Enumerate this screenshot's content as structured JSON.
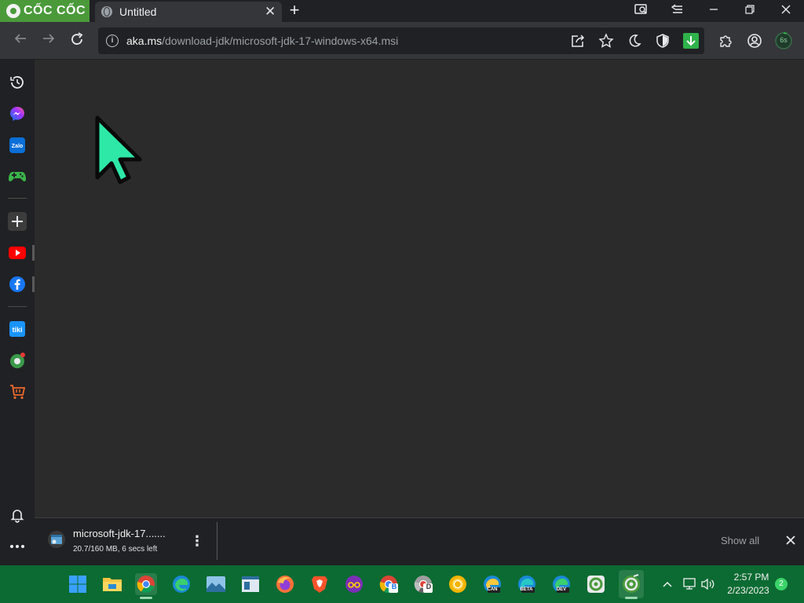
{
  "browser": {
    "brand": "CỐC CỐC",
    "tab_title": "Untitled",
    "url_host": "aka.ms",
    "url_path": "/download-jdk/microsoft-jdk-17-windows-x64.msi",
    "download_badge_text": "6s"
  },
  "download_shelf": {
    "file_name": "microsoft-jdk-17.......",
    "status": "20.7/160 MB, 6 secs left",
    "show_all_label": "Show all"
  },
  "taskbar": {
    "time": "2:57 PM",
    "date": "2/23/2023",
    "notification_count": "2",
    "badges": {
      "edge_canary": "CAN",
      "edge_beta": "BETA",
      "edge_dev": "DEV",
      "chrome_beta": "B",
      "chrome_dev": "D"
    }
  },
  "colors": {
    "accent_green": "#4a9a3a",
    "download_green": "#2fb24a",
    "taskbar_green": "#0b6b32",
    "cursor_fill": "#2ee8a8"
  }
}
